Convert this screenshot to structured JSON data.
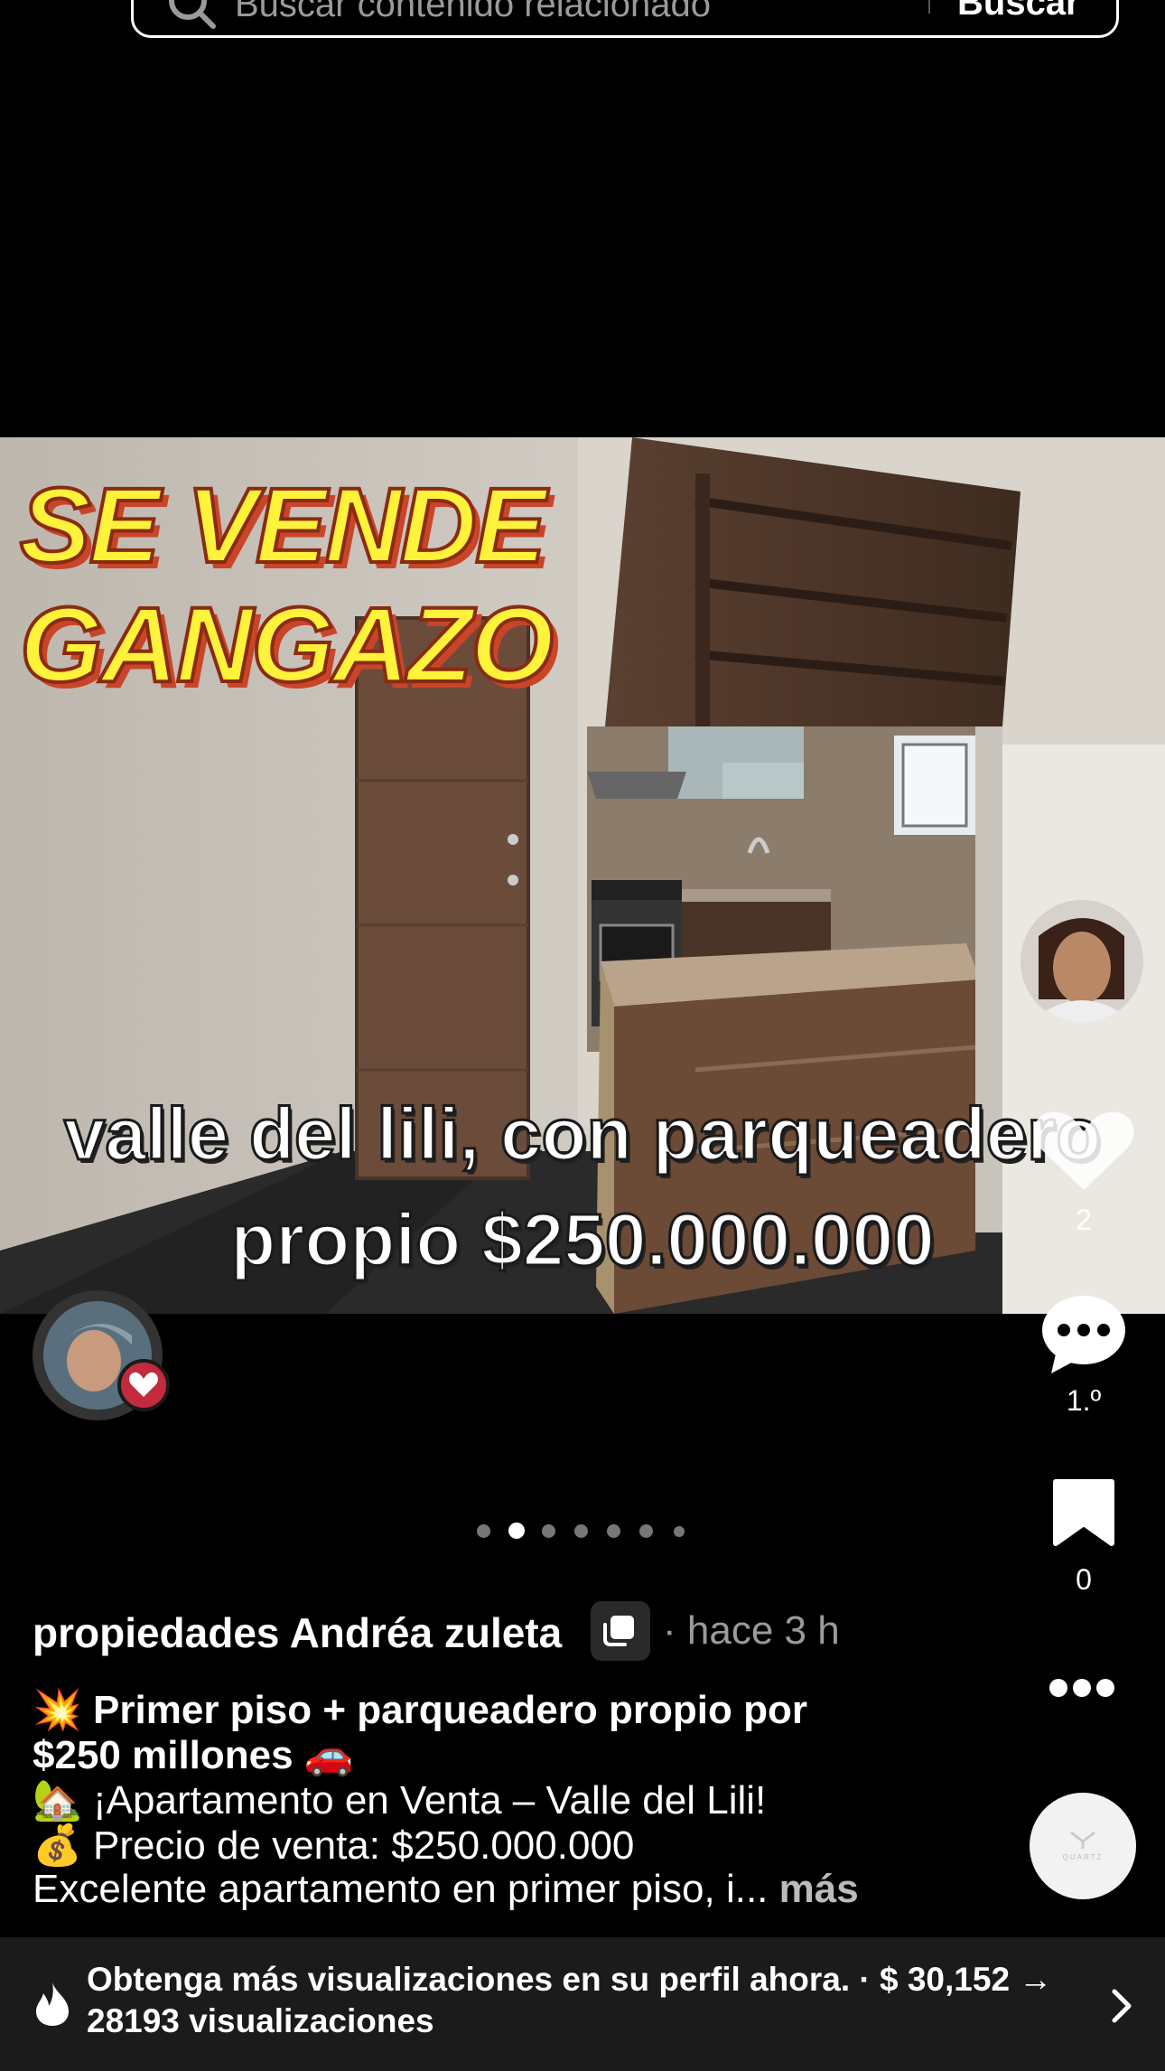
{
  "search": {
    "placeholder": "Buscar contenido relacionado",
    "button_label": "Buscar"
  },
  "post": {
    "headline_line1": "SE VENDE",
    "headline_line2": "GANGAZO",
    "caption_line1": "valle del lili, con parqueadero",
    "caption_line2": "propio $250.000.000",
    "slide_count": 7,
    "active_slide": 1
  },
  "actions": {
    "likes": "2",
    "comments": "1.º",
    "saves": "0"
  },
  "author": {
    "username": "propiedades Andréa zuleta",
    "time": "· hace 3 h"
  },
  "description": {
    "line1_emoji": "💥",
    "line1": "Primer piso + parqueadero propio por",
    "line2": "$250 millones",
    "line2_emoji": "🚗",
    "line3_emoji": "🏡",
    "line3": "¡Apartamento en Venta – Valle del Lili!",
    "line4_emoji": "💰",
    "line4": "Precio de venta: $250.000.000",
    "line5": "Excelente apartamento en primer piso, i...",
    "more": "más"
  },
  "music_disc_label": "QUARTZ",
  "promo": {
    "line1": "Obtenga más visualizaciones en su perfil ahora. · $ 30,152 →",
    "line2": "28193 visualizaciones"
  }
}
